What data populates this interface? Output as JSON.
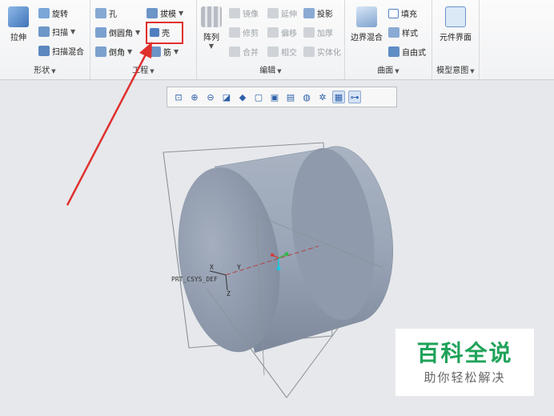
{
  "ribbon": {
    "shape": {
      "label": "形状",
      "extrude": "拉伸",
      "revolve": "旋转",
      "sweep": "扫描",
      "swept_blend": "扫描混合"
    },
    "engineering": {
      "label": "工程",
      "hole": "孔",
      "draft": "拔模",
      "round": "倒圆角",
      "shell": "壳",
      "chamfer": "倒角",
      "rib": "筋"
    },
    "editing": {
      "label": "编辑",
      "pattern": "阵列",
      "mirror": "镜像",
      "extend": "延伸",
      "project": "投影",
      "trim": "修剪",
      "offset": "偏移",
      "thicken": "加厚",
      "merge": "合并",
      "intersect": "相交",
      "solidify": "实体化"
    },
    "surfaces": {
      "label": "曲面",
      "boundary_blend": "边界混合",
      "fill": "填充",
      "style": "样式",
      "freestyle": "自由式"
    },
    "model_intent": {
      "label": "模型意图",
      "component_interface": "元件界面"
    }
  },
  "viewport": {
    "csys_label": "PRT_CSYS_DEF",
    "axis_x": "X",
    "axis_y": "Y",
    "axis_z": "Z"
  },
  "watermark": {
    "title": "百科全说",
    "subtitle": "助你轻松解决"
  },
  "colors": {
    "highlight": "#e0302e",
    "model_body": "#8e9aae",
    "watermark_green": "#20a35a"
  }
}
